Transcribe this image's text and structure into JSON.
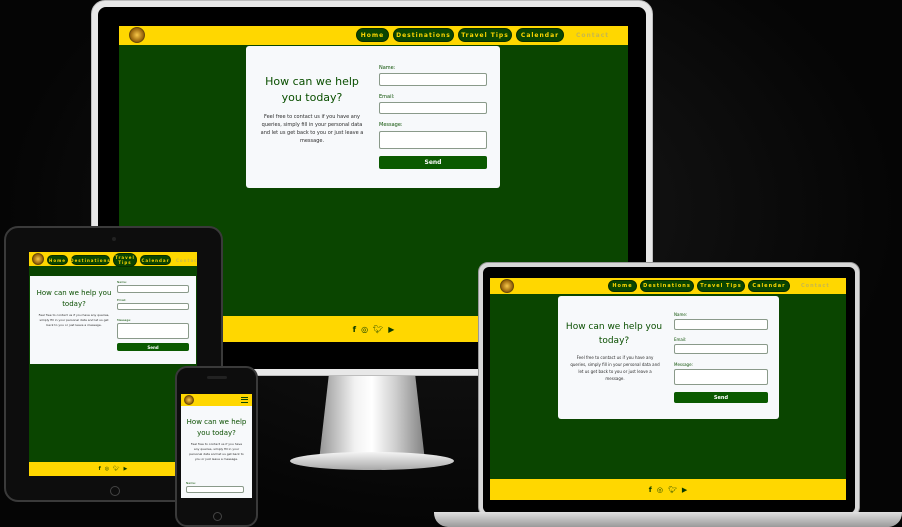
{
  "nav": {
    "home": "Home",
    "destinations": "Destinations",
    "travel_tips": "Travel Tips",
    "calendar": "Calendar",
    "contact": "Contact"
  },
  "form": {
    "heading": "How can we help you today?",
    "intro": "Feel free to contact us if you have any queries, simply fill in your personal data and let us get back to you or just leave a message.",
    "name_label": "Name:",
    "email_label": "Email:",
    "message_label": "Message:",
    "send_label": "Send"
  },
  "social_icons": [
    "facebook-icon",
    "instagram-icon",
    "twitter-icon",
    "youtube-icon"
  ],
  "colors": {
    "brand_yellow": "#ffd700",
    "brand_green": "#0a4500",
    "button_green": "#0a5a00"
  }
}
